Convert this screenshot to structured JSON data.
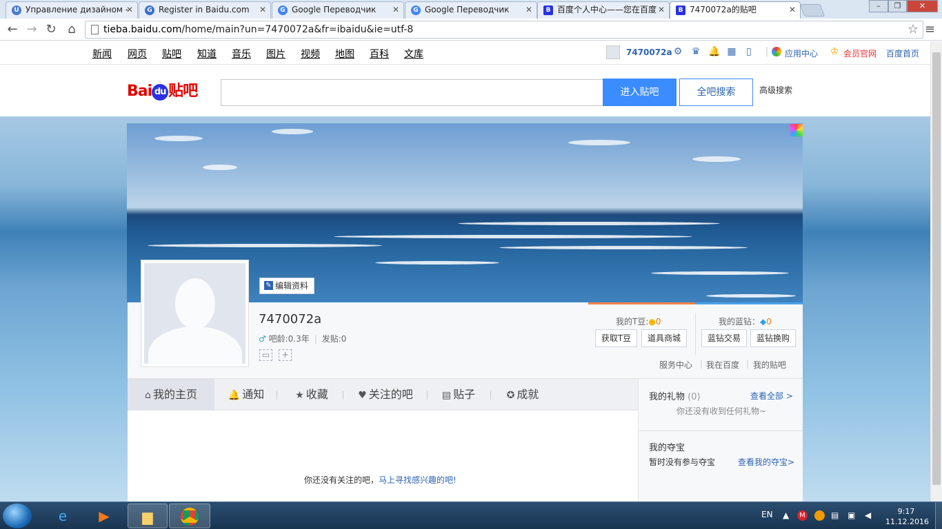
{
  "browser": {
    "tabs": [
      {
        "label": "Управление дизайном - ",
        "icon": "U"
      },
      {
        "label": "Register in Baidu.com",
        "icon": "G"
      },
      {
        "label": "Google Переводчик",
        "icon": "G"
      },
      {
        "label": "Google Переводчик",
        "icon": "G"
      },
      {
        "label": "百度个人中心——您在百度",
        "icon": "B"
      },
      {
        "label": "7470072a的贴吧",
        "icon": "B"
      }
    ],
    "url_host": "tieba.baidu.com",
    "url_path": "/home/main?un=7470072a&fr=ibaidu&ie=utf-8",
    "window_buttons": [
      "–",
      "❐",
      "✕"
    ]
  },
  "topnav": {
    "links": [
      "新闻",
      "网页",
      "贴吧",
      "知道",
      "音乐",
      "图片",
      "视频",
      "地图",
      "百科",
      "文库"
    ],
    "username": "7470072a",
    "app_center": "应用中心",
    "vip": "会员官网",
    "home": "百度首页"
  },
  "search": {
    "logo_bai": "Bai",
    "logo_du": "du",
    "logo_tieba": "贴吧",
    "enter_label": "进入贴吧",
    "all_label": "全吧搜索",
    "advanced": "高级搜索",
    "value": ""
  },
  "profile": {
    "edit": "编辑资料",
    "name": "7470072a",
    "age_label": "吧龄:0.3年",
    "posts_label": "发贴:0",
    "tdou_label": "我的T豆:",
    "tdou_value": "0",
    "diamond_label": "我的蓝钻：",
    "diamond_value": "0",
    "btn_get_tdou": "获取T豆",
    "btn_shop": "道具商城",
    "btn_trade": "蓝钻交易",
    "btn_exchange": "蓝钻换购",
    "service": "服务中心",
    "in_baidu": "我在百度",
    "my_tieba": "我的贴吧"
  },
  "tabs": [
    {
      "label": "我的主页",
      "icon": "⌂"
    },
    {
      "label": "通知",
      "icon": "🔔"
    },
    {
      "label": "收藏",
      "icon": "★"
    },
    {
      "label": "关注的吧",
      "icon": "♥"
    },
    {
      "label": "贴子",
      "icon": "▤"
    },
    {
      "label": "成就",
      "icon": "✪"
    }
  ],
  "main": {
    "empty_text": "你还没有关注的吧，",
    "empty_link": "马上寻找感兴趣的吧!"
  },
  "sidebar": {
    "gift_title": "我的礼物",
    "gift_count": "(0)",
    "gift_link": "查看全部 >",
    "gift_empty": "你还没有收到任何礼物~",
    "treasure_title": "我的夺宝",
    "treasure_empty": "暂时没有参与夺宝",
    "treasure_link": "查看我的夺宝>"
  },
  "taskbar": {
    "lang": "EN",
    "time": "9:17",
    "date": "11.12.2016"
  },
  "colors": {
    "baidu_blue": "#3a8cff",
    "link_blue": "#2d64b3",
    "orange": "#f5780e"
  }
}
